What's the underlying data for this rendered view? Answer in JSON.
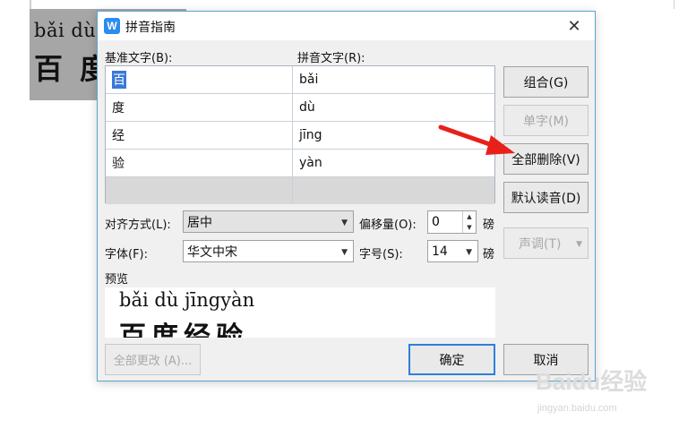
{
  "document": {
    "pinyin_line": "bǎi dù",
    "hanzi_line": "百 度"
  },
  "dialog": {
    "title": "拼音指南",
    "app_icon_glyph": "W",
    "close_glyph": "✕",
    "base_text_label": "基准文字(B):",
    "pinyin_text_label": "拼音文字(R):",
    "rows": [
      {
        "base": "百",
        "pinyin": "bǎi"
      },
      {
        "base": "度",
        "pinyin": "dù"
      },
      {
        "base": "经",
        "pinyin": "jīng"
      },
      {
        "base": "验",
        "pinyin": "yàn"
      }
    ],
    "buttons": {
      "group": "组合(G)",
      "single": "单字(M)",
      "delete_all": "全部删除(V)",
      "default_reading": "默认读音(D)",
      "tone": "声调(T)",
      "change_all": "全部更改 (A)...",
      "ok": "确定",
      "cancel": "取消"
    },
    "alignment": {
      "label": "对齐方式(L):",
      "value": "居中"
    },
    "offset": {
      "label": "偏移量(O):",
      "value": "0",
      "unit": "磅"
    },
    "font": {
      "label": "字体(F):",
      "value": "华文中宋"
    },
    "font_size": {
      "label": "字号(S):",
      "value": "14",
      "unit": "磅"
    },
    "preview": {
      "label": "预览",
      "pinyin": "bǎi dù jīngyàn",
      "hanzi": "百度经验"
    }
  },
  "watermark": {
    "logo": "Baidu经验",
    "url": "jingyan.baidu.com"
  },
  "colors": {
    "dialog_border": "#5aa3cf",
    "selection": "#3b78d8",
    "primary_border": "#2f7fd8",
    "arrow": "#e8201a"
  }
}
